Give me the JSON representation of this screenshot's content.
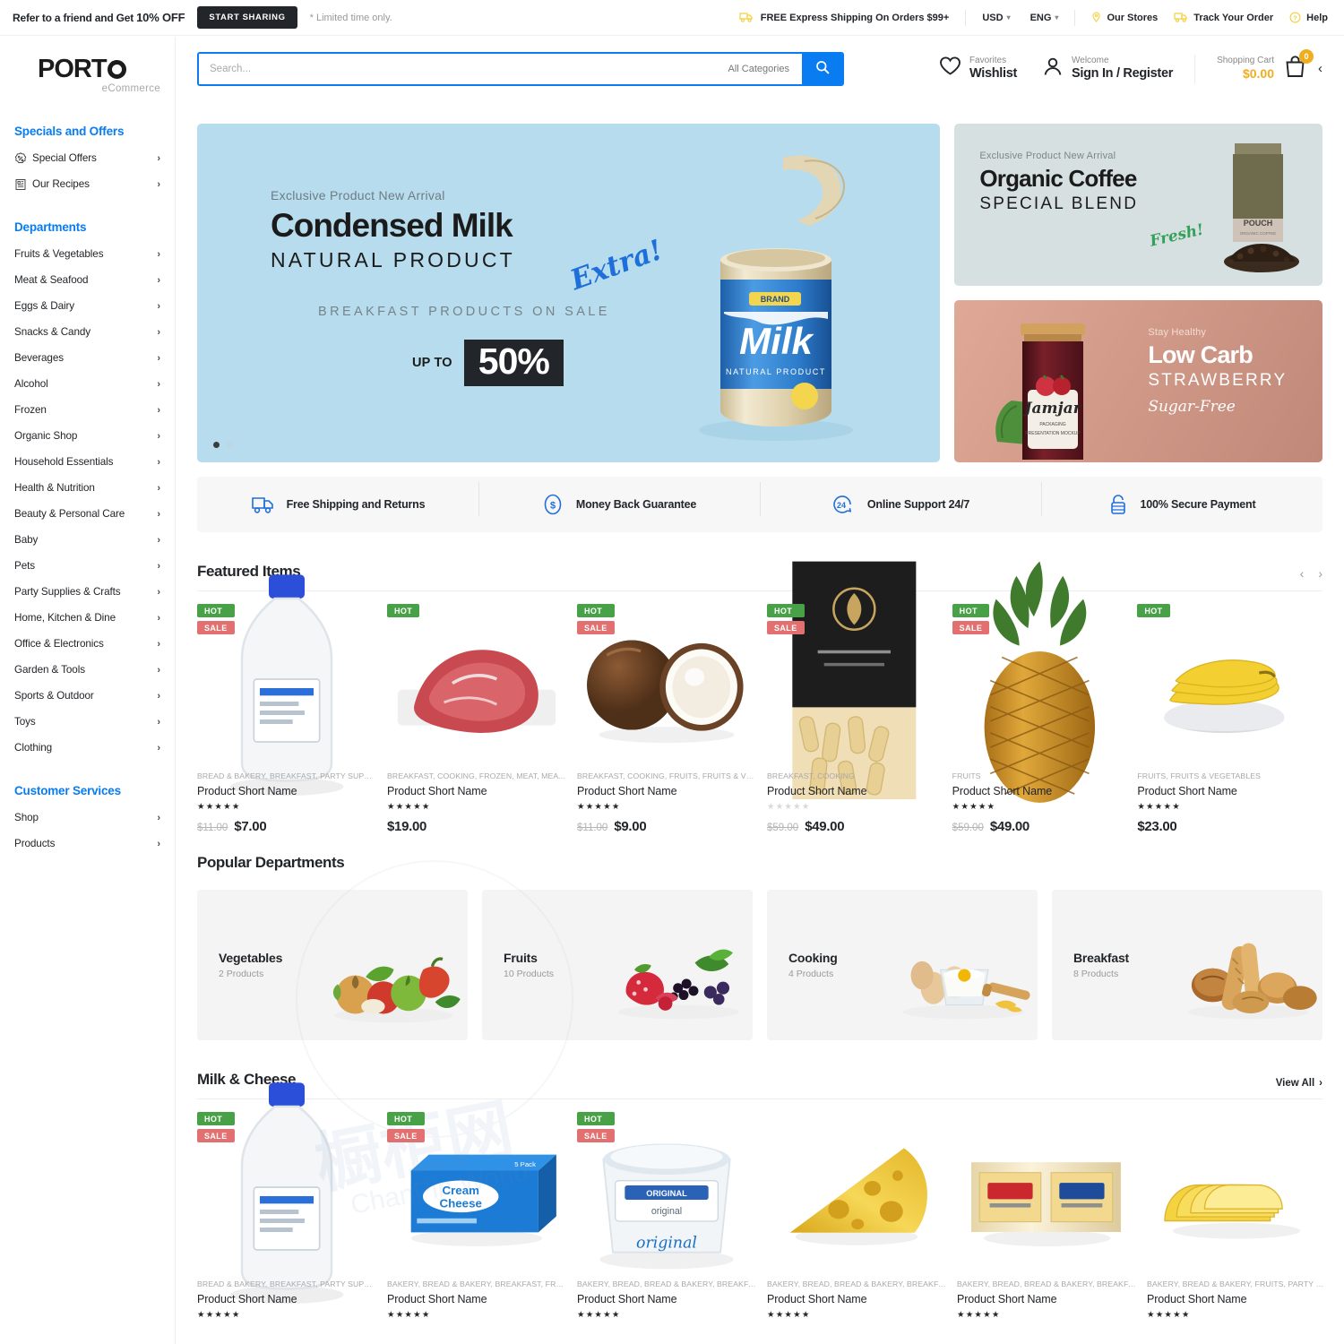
{
  "topbar": {
    "refer_text": "Refer to a friend and Get ",
    "refer_pct": "10% OFF",
    "share_button": "START SHARING",
    "limited": "* Limited time only.",
    "shipping": "FREE Express Shipping On Orders $99+",
    "currency": "USD",
    "language": "ENG",
    "stores": "Our Stores",
    "track": "Track Your Order",
    "help": "Help"
  },
  "brand": {
    "name": "PORT",
    "tagline": "eCommerce"
  },
  "search": {
    "placeholder": "Search...",
    "value": "",
    "category": "All Categories"
  },
  "account": {
    "wishlist_top": "Favorites",
    "wishlist_main": "Wishlist",
    "signin_top": "Welcome",
    "signin_main": "Sign In / Register",
    "cart_top": "Shopping Cart",
    "cart_price": "$0.00",
    "cart_count": "0"
  },
  "sidebar": {
    "specials_heading": "Specials and Offers",
    "specials": [
      {
        "label": "Special Offers",
        "icon": "percent-badge-icon"
      },
      {
        "label": "Our Recipes",
        "icon": "recipe-book-icon"
      }
    ],
    "departments_heading": "Departments",
    "departments": [
      {
        "label": "Fruits & Vegetables"
      },
      {
        "label": "Meat & Seafood"
      },
      {
        "label": "Eggs & Dairy"
      },
      {
        "label": "Snacks & Candy"
      },
      {
        "label": "Beverages"
      },
      {
        "label": "Alcohol"
      },
      {
        "label": "Frozen"
      },
      {
        "label": "Organic Shop"
      },
      {
        "label": "Household Essentials"
      },
      {
        "label": "Health & Nutrition"
      },
      {
        "label": "Beauty & Personal Care"
      },
      {
        "label": "Baby"
      },
      {
        "label": "Pets"
      },
      {
        "label": "Party Supplies & Crafts"
      },
      {
        "label": "Home, Kitchen & Dine"
      },
      {
        "label": "Office & Electronics"
      },
      {
        "label": "Garden & Tools"
      },
      {
        "label": "Sports & Outdoor"
      },
      {
        "label": "Toys"
      },
      {
        "label": "Clothing"
      }
    ],
    "services_heading": "Customer Services",
    "services": [
      {
        "label": "Shop"
      },
      {
        "label": "Products"
      }
    ]
  },
  "hero": {
    "kicker": "Exclusive Product New Arrival",
    "title": "Condensed Milk",
    "subtitle": "NATURAL PRODUCT",
    "extra": "Extra!",
    "breakfast": "BREAKFAST PRODUCTS ON SALE",
    "upto": "UP TO",
    "discount": "50%"
  },
  "promos": [
    {
      "kicker": "Exclusive Product New Arrival",
      "title": "Organic Coffee",
      "subtitle": "SPECIAL BLEND",
      "script": "Fresh!"
    },
    {
      "kicker": "Stay Healthy",
      "title": "Low Carb",
      "subtitle": "STRAWBERRY",
      "script": "Sugar-Free"
    }
  ],
  "features": [
    {
      "label": "Free Shipping and Returns",
      "icon": "delivery-truck-icon"
    },
    {
      "label": "Money Back Guarantee",
      "icon": "dollar-circle-icon"
    },
    {
      "label": "Online Support 24/7",
      "icon": "support-24-icon"
    },
    {
      "label": "100% Secure Payment",
      "icon": "lock-icon"
    }
  ],
  "featured": {
    "title": "Featured Items",
    "products": [
      {
        "badges": [
          "HOT",
          "SALE"
        ],
        "cats": "BREAD & BAKERY, BREAKFAST, PARTY SUPPLIES &...",
        "name": "Product Short Name",
        "rating": 5,
        "old_price": "$11.00",
        "price": "$7.00",
        "image": "milk-jug"
      },
      {
        "badges": [
          "HOT"
        ],
        "cats": "BREAKFAST, COOKING, FROZEN, MEAT, MEAT & S...",
        "name": "Product Short Name",
        "rating": 5,
        "old_price": "",
        "price": "$19.00",
        "image": "raw-meat"
      },
      {
        "badges": [
          "HOT",
          "SALE"
        ],
        "cats": "BREAKFAST, COOKING, FRUITS, FRUITS & VEGETA...",
        "name": "Product Short Name",
        "rating": 5,
        "old_price": "$11.00",
        "price": "$9.00",
        "image": "coconut"
      },
      {
        "badges": [
          "HOT",
          "SALE"
        ],
        "cats": "BREAKFAST, COOKING",
        "name": "Product Short Name",
        "rating": 0,
        "old_price": "$59.00",
        "price": "$49.00",
        "image": "pasta-box"
      },
      {
        "badges": [
          "HOT",
          "SALE"
        ],
        "cats": "FRUITS",
        "name": "Product Short Name",
        "rating": 5,
        "old_price": "$59.00",
        "price": "$49.00",
        "image": "pineapple"
      },
      {
        "badges": [
          "HOT"
        ],
        "cats": "FRUITS, FRUITS & VEGETABLES",
        "name": "Product Short Name",
        "rating": 5,
        "old_price": "",
        "price": "$23.00",
        "image": "bananas"
      }
    ]
  },
  "departments_section": {
    "title": "Popular Departments",
    "items": [
      {
        "name": "Vegetables",
        "count": "2 Products",
        "image": "vegetables"
      },
      {
        "name": "Fruits",
        "count": "10 Products",
        "image": "berries"
      },
      {
        "name": "Cooking",
        "count": "4 Products",
        "image": "baking"
      },
      {
        "name": "Breakfast",
        "count": "8 Products",
        "image": "bread"
      }
    ]
  },
  "milk_cheese": {
    "title": "Milk & Cheese",
    "view_all": "View All",
    "products": [
      {
        "badges": [
          "HOT",
          "SALE"
        ],
        "cats": "BREAD & BAKERY, BREAKFAST, PARTY SUPPLIES &...",
        "name": "Product Short Name",
        "rating": 5,
        "image": "milk-jug"
      },
      {
        "badges": [
          "HOT",
          "SALE"
        ],
        "cats": "BAKERY, BREAD & BAKERY, BREAKFAST, FROZEN, ...",
        "name": "Product Short Name",
        "rating": 5,
        "image": "cream-cheese-box"
      },
      {
        "badges": [
          "HOT",
          "SALE"
        ],
        "cats": "BAKERY, BREAD, BREAD & BAKERY, BREAKFAST, F...",
        "name": "Product Short Name",
        "rating": 5,
        "image": "cream-cheese-tub"
      },
      {
        "badges": [],
        "cats": "BAKERY, BREAD, BREAD & BAKERY, BREAKFAST, P...",
        "name": "Product Short Name",
        "rating": 5,
        "image": "swiss-cheese"
      },
      {
        "badges": [],
        "cats": "BAKERY, BREAD, BREAD & BAKERY, BREAKFAST",
        "name": "Product Short Name",
        "rating": 5,
        "image": "cheese-pack"
      },
      {
        "badges": [],
        "cats": "BAKERY, BREAD & BAKERY, FRUITS, PARTY SUPPL...",
        "name": "Product Short Name",
        "rating": 5,
        "image": "cheese-slices"
      }
    ]
  },
  "colors": {
    "accent_blue": "#087cf0",
    "amber": "#f0ad1f",
    "hot_green": "#48a147",
    "sale_red": "#e27070",
    "hero_bg": "#b6dcee",
    "coffee_bg": "#d7e0e0",
    "jam_bg": "#c08878"
  }
}
